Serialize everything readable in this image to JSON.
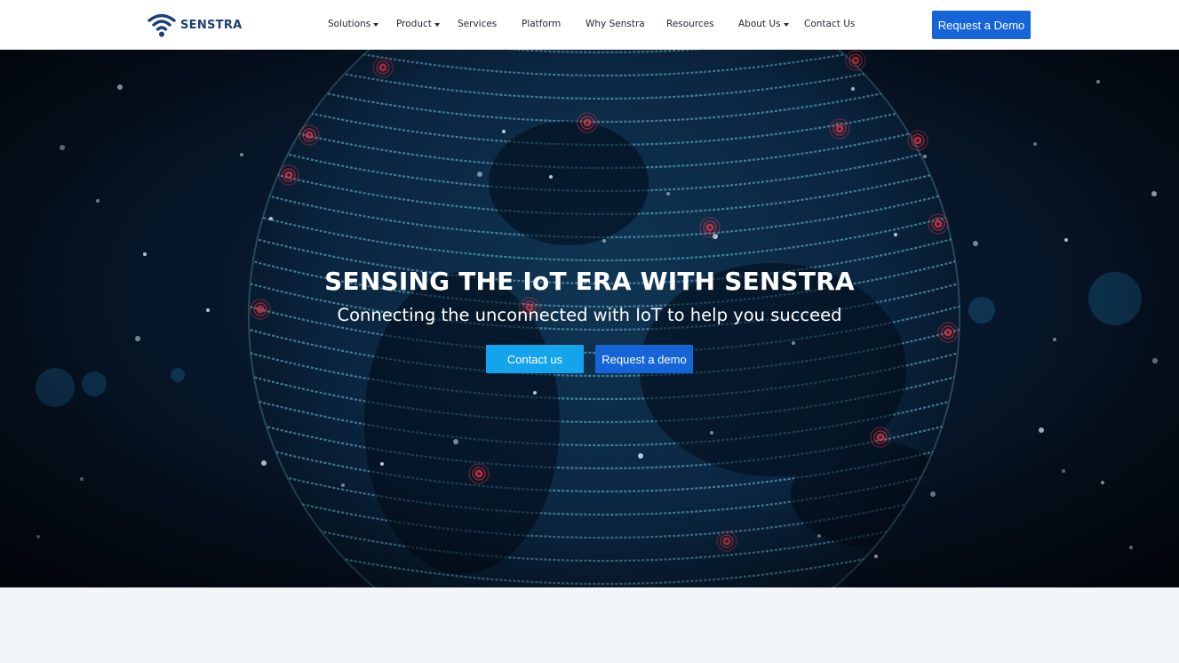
{
  "brand": {
    "name": "SENSTRA",
    "color": "#1e3f73",
    "accent": "#1565d8"
  },
  "nav": {
    "items": [
      {
        "label": "Solutions",
        "has_dropdown": true
      },
      {
        "label": "Product",
        "has_dropdown": true
      },
      {
        "label": "Services",
        "has_dropdown": false
      },
      {
        "label": "Platform",
        "has_dropdown": false
      },
      {
        "label": "Why Senstra",
        "has_dropdown": false
      },
      {
        "label": "Resources",
        "has_dropdown": false
      },
      {
        "label": "About Us",
        "has_dropdown": true
      },
      {
        "label": "Contact Us",
        "has_dropdown": false
      }
    ],
    "cta_label": "Request a Demo"
  },
  "hero": {
    "title": "SENSING THE IoT ERA WITH SENSTRA",
    "subtitle": "Connecting the unconnected with IoT to help you succeed",
    "buttons": {
      "contact_label": "Contact us",
      "demo_label": "Request a demo"
    }
  },
  "icons": {
    "logo": "wifi-signal-icon",
    "dropdown": "caret-down-icon"
  },
  "colors": {
    "contact_button": "#14a4ec",
    "demo_button": "#1565d8",
    "hero_background": "#07172a",
    "hotspot": "#e2333f"
  }
}
